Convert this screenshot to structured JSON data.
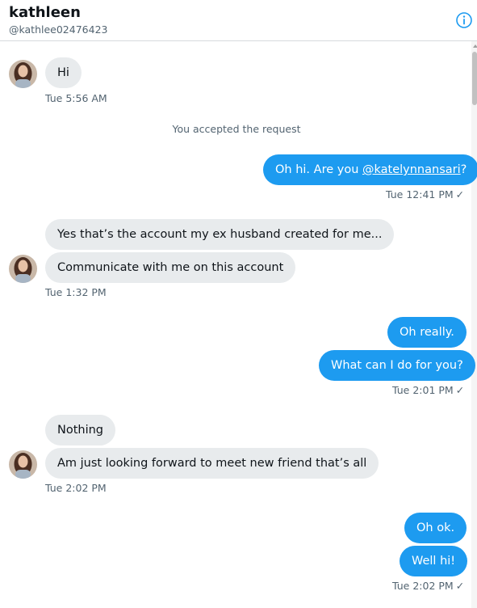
{
  "header": {
    "name": "kathleen",
    "handle": "@kathlee02476423",
    "info_icon": "info-icon",
    "accent": "#1d9bf0"
  },
  "system_message": "You accepted the request",
  "messages": {
    "m1": "Hi",
    "t1": "Tue 5:56 AM",
    "m2_prefix": "Oh hi. Are you ",
    "m2_mention": "@katelynnansari",
    "m2_suffix": "?",
    "t2": "Tue 12:41 PM",
    "m3": "Yes that’s the account my ex husband created for me...",
    "m4": "Communicate with me on this account",
    "t3": "Tue 1:32 PM",
    "m5": "Oh really.",
    "m6": "What can I do for you?",
    "t4": "Tue 2:01 PM",
    "m7": "Nothing",
    "m8": "Am just looking forward to meet new friend that’s all",
    "t5": "Tue 2:02 PM",
    "m9": "Oh ok.",
    "m10": "Well hi!",
    "t6": "Tue 2:02 PM",
    "check": "✓"
  }
}
